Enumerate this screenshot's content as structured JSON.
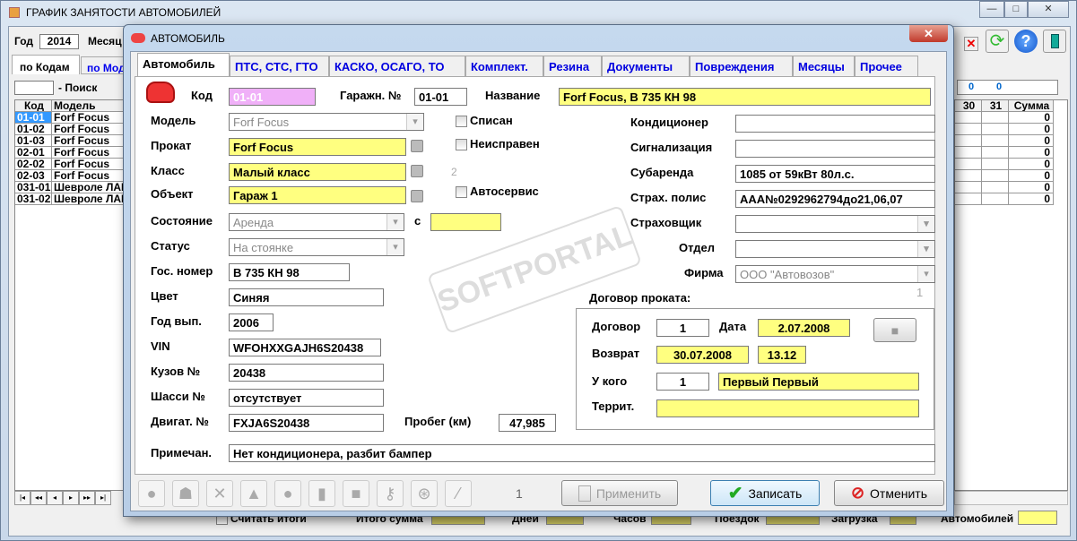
{
  "main_window": {
    "title": "ГРАФИК ЗАНЯТОСТИ АВТОМОБИЛЕЙ",
    "year_label": "Год",
    "year": "2014",
    "month_label": "Месяц",
    "tabs": [
      "по Кодам",
      "по Мод"
    ],
    "search_label": "- Поиск",
    "search_value": "",
    "grid_headers": [
      "Код",
      "Модель"
    ],
    "rows": [
      [
        "01-01",
        "Forf Focus"
      ],
      [
        "01-02",
        "Forf Focus"
      ],
      [
        "01-03",
        "Forf Focus"
      ],
      [
        "02-01",
        "Forf Focus"
      ],
      [
        "02-02",
        "Forf Focus"
      ],
      [
        "02-03",
        "Forf Focus"
      ],
      [
        "031-01",
        "Шевроле ЛАНОС"
      ],
      [
        "031-02",
        "Шевроле ЛАНОС"
      ]
    ],
    "right_totals": [
      "0",
      "0"
    ],
    "right_headers": [
      "30",
      "31",
      "Сумма"
    ],
    "sums": [
      "0",
      "0",
      "0",
      "0",
      "0",
      "0",
      "0",
      "0"
    ],
    "nav": [
      "|◂",
      "◂◂",
      "◂",
      "▸",
      "▸▸",
      "▸|"
    ],
    "footer": {
      "count_totals": "Считать итоги",
      "total_sum": "Итого сумма",
      "days": "Дней",
      "hours": "Часов",
      "trips": "Поездок",
      "load": "Загрузка",
      "cars": "Автомобилей"
    },
    "window_buttons": [
      "—",
      "□",
      "✕"
    ]
  },
  "dialog": {
    "title": "АВТОМОБИЛЬ",
    "close": "✕",
    "tabs": [
      "Автомобиль",
      "ПТС, СТС, ГТО",
      "КАСКО, ОСАГО, ТО",
      "Комплект.",
      "Резина",
      "Документы",
      "Повреждения",
      "Месяцы",
      "Прочее"
    ],
    "fields": {
      "kod_label": "Код",
      "kod": "01-01",
      "garage_label": "Гаражн. №",
      "garage": "01-01",
      "name_label": "Название",
      "name": "Forf Focus, В 735 КН 98",
      "model_label": "Модель",
      "model": "Forf Focus",
      "rent_label": "Прокат",
      "rent": "Forf Focus",
      "class_label": "Класс",
      "class": "Малый класс",
      "class_count": "2",
      "object_label": "Объект",
      "object": "Гараж 1",
      "state_label": "Состояние",
      "state": "Аренда",
      "from_label": "с",
      "from": "",
      "status_label": "Статус",
      "status": "На стоянке",
      "plate_label": "Гос. номер",
      "plate": "В 735 КН 98",
      "color_label": "Цвет",
      "color": "Синяя",
      "year_label": "Год вып.",
      "year": "2006",
      "vin_label": "VIN",
      "vin": "WFOHXXGAJH6S20438",
      "body_label": "Кузов №",
      "body": "20438",
      "chassis_label": "Шасси №",
      "chassis": "отсутствует",
      "engine_label": "Двигат. №",
      "engine": "FXJA6S20438",
      "mileage_label": "Пробег (км)",
      "mileage": "47,985",
      "note_label": "Примечан.",
      "note": "Нет кондиционера, разбит бампер",
      "written_off": "Списан",
      "broken": "Неисправен",
      "service": "Автосервис",
      "ac_label": "Кондиционер",
      "ac": "",
      "alarm_label": "Сигнализация",
      "alarm": "",
      "sublease_label": "Субаренда",
      "sublease": "1085 от 59кВт  80л.с.",
      "policy_label": "Страх. полис",
      "policy": "ААА№0292962794до21,06,07",
      "insurer_label": "Страховщик",
      "insurer": "",
      "dept_label": "Отдел",
      "dept": "",
      "firm_label": "Фирма",
      "firm": "ООО \"Автовозов\""
    },
    "contract": {
      "title": "Договор проката:",
      "count": "1",
      "contract_label": "Договор",
      "contract": "1",
      "date_label": "Дата",
      "date": "2.07.2008",
      "return_label": "Возврат",
      "return_date": "30.07.2008",
      "return_time": "13.12",
      "who_label": "У кого",
      "who_id": "1",
      "who": "Первый Первый",
      "territory_label": "Террит.",
      "territory": ""
    },
    "page": "1",
    "apply": "Применить",
    "save": "Записать",
    "cancel": "Отменить"
  },
  "watermark": "SOFTPORTAL"
}
